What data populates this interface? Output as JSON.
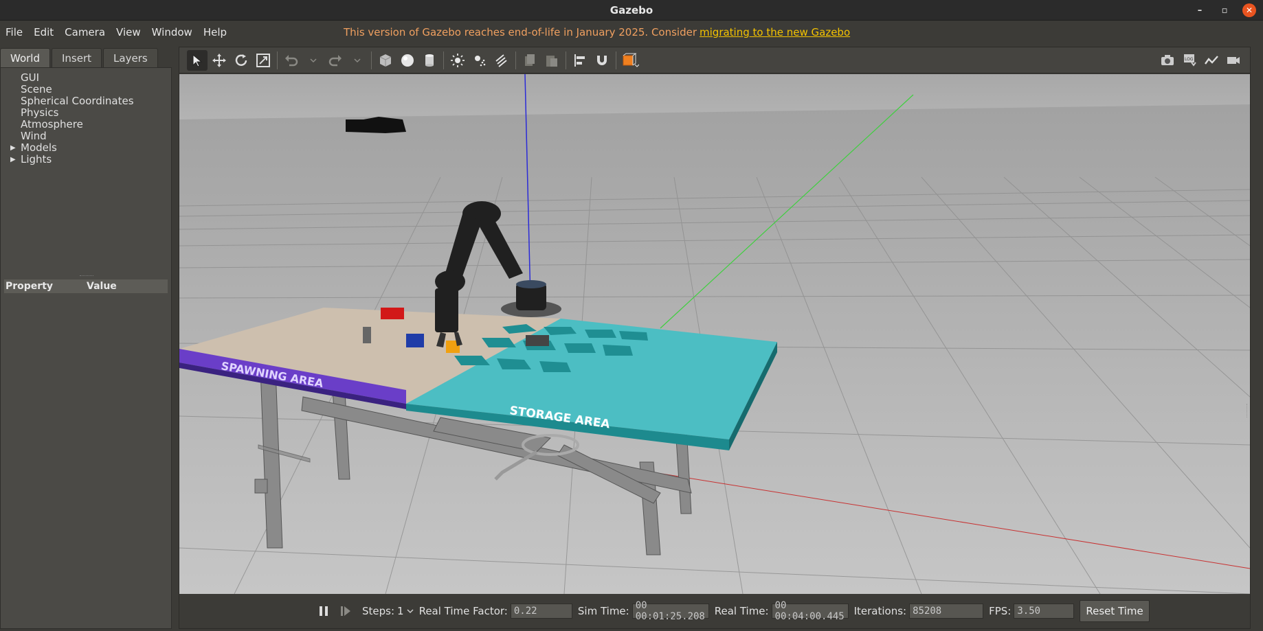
{
  "window": {
    "title": "Gazebo",
    "minimize": "–",
    "maximize": "▫",
    "close": "✕"
  },
  "menu": {
    "items": [
      "File",
      "Edit",
      "Camera",
      "View",
      "Window",
      "Help"
    ],
    "notice_text": "This version of Gazebo reaches end-of-life in January 2025. Consider",
    "notice_link": "migrating to the new Gazebo"
  },
  "left_panel": {
    "tabs": [
      "World",
      "Insert",
      "Layers"
    ],
    "tree": [
      {
        "label": "GUI",
        "expandable": false
      },
      {
        "label": "Scene",
        "expandable": false
      },
      {
        "label": "Spherical Coordinates",
        "expandable": false
      },
      {
        "label": "Physics",
        "expandable": false
      },
      {
        "label": "Atmosphere",
        "expandable": false
      },
      {
        "label": "Wind",
        "expandable": false
      },
      {
        "label": "Models",
        "expandable": true
      },
      {
        "label": "Lights",
        "expandable": true
      }
    ],
    "property_header": {
      "property": "Property",
      "value": "Value"
    }
  },
  "toolbar": {
    "tools": [
      {
        "name": "select-tool",
        "icon": "arrow-cursor-icon"
      },
      {
        "name": "translate-tool",
        "icon": "move-arrows-icon"
      },
      {
        "name": "rotate-tool",
        "icon": "rotate-icon"
      },
      {
        "name": "scale-tool",
        "icon": "scale-icon"
      },
      {
        "name": "undo",
        "icon": "undo-icon"
      },
      {
        "name": "redo",
        "icon": "redo-icon"
      },
      {
        "name": "box-shape",
        "icon": "box-icon"
      },
      {
        "name": "sphere-shape",
        "icon": "sphere-icon"
      },
      {
        "name": "cylinder-shape",
        "icon": "cylinder-icon"
      },
      {
        "name": "point-light",
        "icon": "sun-icon"
      },
      {
        "name": "spot-light",
        "icon": "spot-light-icon"
      },
      {
        "name": "directional-light",
        "icon": "directional-light-icon"
      },
      {
        "name": "copy",
        "icon": "copy-icon"
      },
      {
        "name": "paste",
        "icon": "paste-icon"
      },
      {
        "name": "align",
        "icon": "align-icon"
      },
      {
        "name": "snap",
        "icon": "magnet-icon"
      },
      {
        "name": "view-angle",
        "icon": "view-cube-icon"
      }
    ],
    "right_tools": [
      "camera-icon",
      "log-icon",
      "plot-icon",
      "video-icon"
    ]
  },
  "scene": {
    "spawning_label": "SPAWNING AREA",
    "storage_label": "STORAGE AREA"
  },
  "status": {
    "steps_label": "Steps:",
    "steps_value": "1",
    "rtf_label": "Real Time Factor:",
    "rtf_value": "0.22",
    "sim_time_label": "Sim Time:",
    "sim_time_value": "00 00:01:25.208",
    "real_time_label": "Real Time:",
    "real_time_value": "00 00:04:00.445",
    "iterations_label": "Iterations:",
    "iterations_value": "85208",
    "fps_label": "FPS:",
    "fps_value": "3.50",
    "reset_label": "Reset Time"
  },
  "colors": {
    "accent_close": "#e95420",
    "notice": "#f0a060",
    "link": "#f5c400",
    "storage_area": "#4cbec3",
    "spawning_strip": "#6a3ec8"
  }
}
